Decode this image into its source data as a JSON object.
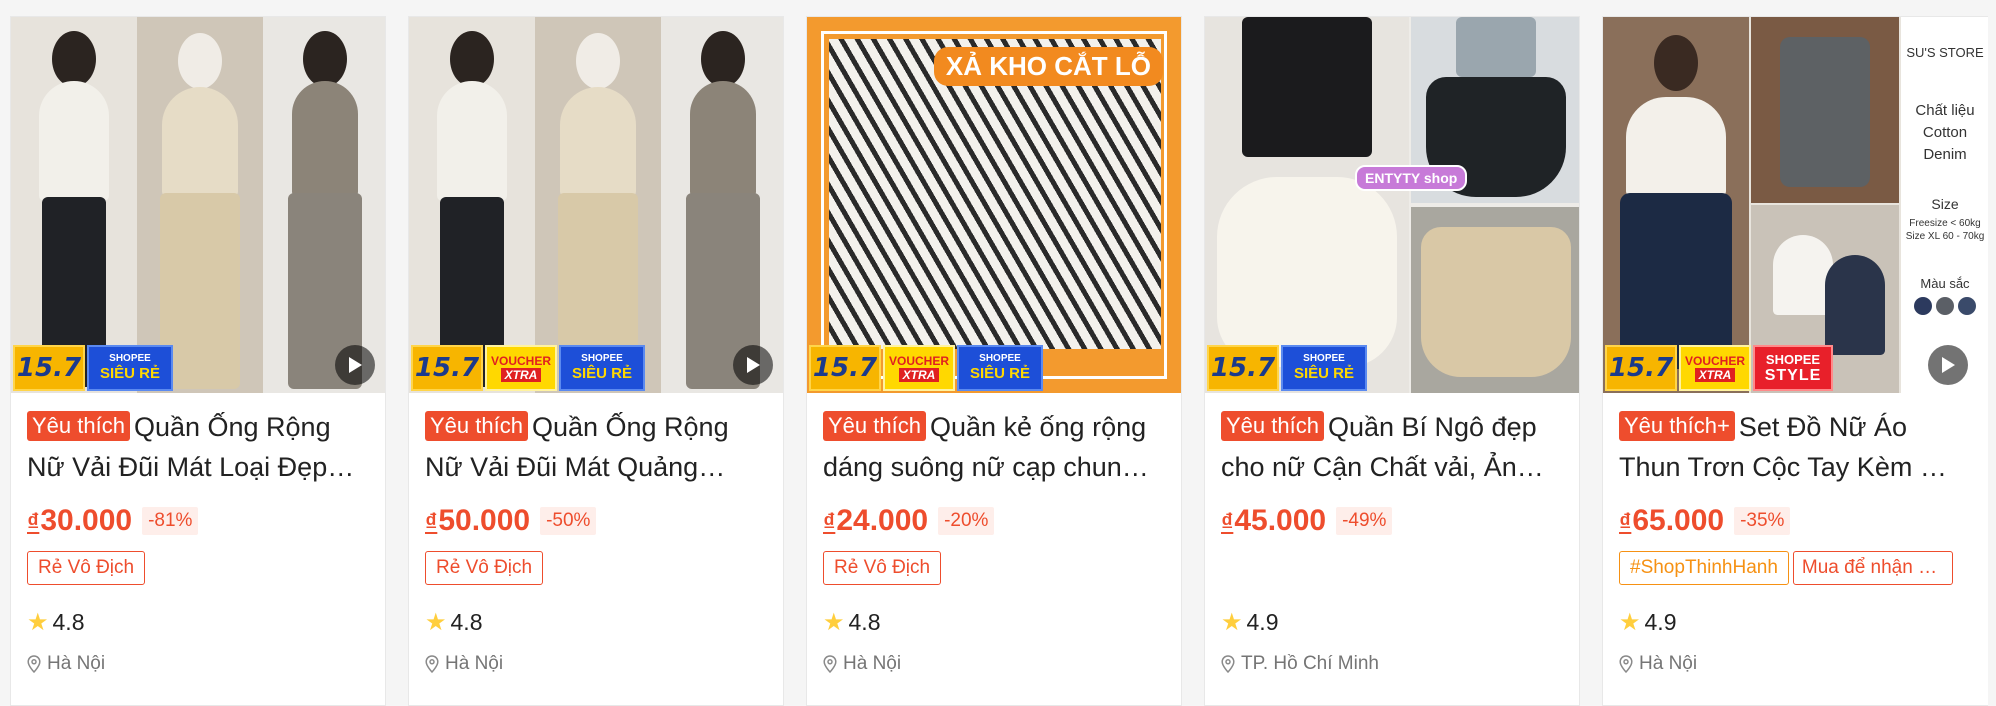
{
  "products": [
    {
      "fav": "Yêu thích",
      "title": "Quần Ống Rộng Nữ Vải Đũi Mát Loại Đẹp…",
      "currency": "₫",
      "price": "30.000",
      "discount": "-81%",
      "tags": [
        "Rẻ Vô Địch"
      ],
      "rating": "4.8",
      "location": "Hà Nội",
      "badges": {
        "num": "15.7",
        "voucher": false,
        "shopee_top": "SHOPEE",
        "shopee_bottom": "SIÊU RẺ"
      }
    },
    {
      "fav": "Yêu thích",
      "title": "Quần Ống Rộng Nữ Vải Đũi Mát Quảng…",
      "currency": "₫",
      "price": "50.000",
      "discount": "-50%",
      "tags": [
        "Rẻ Vô Địch"
      ],
      "rating": "4.8",
      "location": "Hà Nội",
      "badges": {
        "num": "15.7",
        "voucher_top": "VOUCHER",
        "voucher_bottom": "XTRA",
        "shopee_top": "SHOPEE",
        "shopee_bottom": "SIÊU RẺ"
      }
    },
    {
      "fav": "Yêu thích",
      "title": "Quần kẻ ống rộng dáng suông nữ cạp chun…",
      "currency": "₫",
      "price": "24.000",
      "discount": "-20%",
      "tags": [
        "Rẻ Vô Địch"
      ],
      "rating": "4.8",
      "location": "Hà Nội",
      "banner": "XẢ KHO CẮT LỖ",
      "badges": {
        "num": "15.7",
        "voucher_top": "VOUCHER",
        "voucher_bottom": "XTRA",
        "shopee_top": "SHOPEE",
        "shopee_bottom": "SIÊU RẺ"
      }
    },
    {
      "fav": "Yêu thích",
      "title": "Quần Bí Ngô đẹp cho nữ Cận Chất vải, Ản…",
      "currency": "₫",
      "price": "45.000",
      "discount": "-49%",
      "tags": [],
      "rating": "4.9",
      "location": "TP. Hồ Chí Minh",
      "shop_sticker": "ENTYTY shop",
      "badges": {
        "num": "15.7",
        "shopee_top": "SHOPEE",
        "shopee_bottom": "SIÊU RẺ"
      }
    },
    {
      "fav": "Yêu thích+",
      "title": "Set Đồ Nữ Áo Thun Trơn Cộc Tay Kèm …",
      "currency": "₫",
      "price": "65.000",
      "discount": "-35%",
      "tags": [
        "#ShopThinhHanh",
        "Mua để nhận …"
      ],
      "rating": "4.9",
      "location": "Hà Nội",
      "store_text": {
        "store": "SU'S STORE",
        "material": "Chất liệu Cotton Denim",
        "size": "Size",
        "size_free": "Freesize < 60kg",
        "size_xl": "Size XL 60 - 70kg",
        "color": "Màu sắc"
      },
      "badges": {
        "num": "15.7",
        "voucher_top": "VOUCHER",
        "voucher_bottom": "XTRA",
        "style_top": "SHOPEE",
        "style_bottom": "STYLE"
      }
    }
  ],
  "colors": {
    "accent": "#ee4d2d",
    "star": "#ffce3d",
    "tag_orange": "#f69113",
    "badge_yellow": "#f7b500",
    "badge_blue": "#1d4fd8"
  },
  "icons": {
    "play": "play-icon",
    "star": "star-icon",
    "location": "location-pin-icon"
  }
}
